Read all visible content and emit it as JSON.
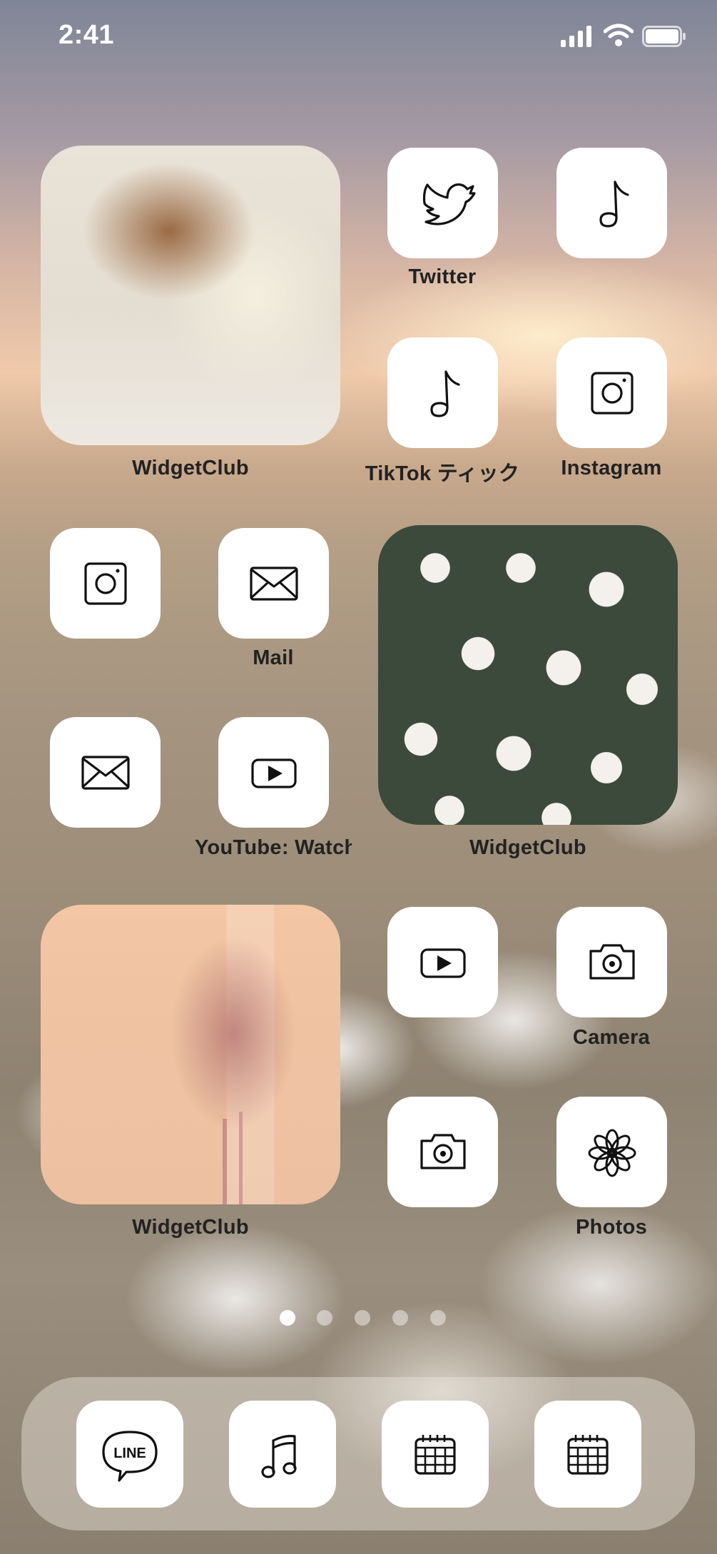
{
  "status": {
    "time": "2:41"
  },
  "widgets": [
    {
      "label": "WidgetClub",
      "photo": "wicker-basket-linen"
    },
    {
      "label": "WidgetClub",
      "photo": "white-daisies"
    },
    {
      "label": "WidgetClub",
      "photo": "dried-flowers-peach"
    }
  ],
  "apps": [
    {
      "label": "Twitter",
      "icon": "bird-icon"
    },
    {
      "label": "",
      "icon": "music-note-icon"
    },
    {
      "label": "TikTok ティック",
      "icon": "music-note-icon"
    },
    {
      "label": "Instagram",
      "icon": "instagram-icon"
    },
    {
      "label": "",
      "icon": "instagram-icon"
    },
    {
      "label": "Mail",
      "icon": "mail-icon"
    },
    {
      "label": "",
      "icon": "mail-icon"
    },
    {
      "label": "YouTube: Watch",
      "icon": "play-icon"
    },
    {
      "label": "",
      "icon": "play-icon"
    },
    {
      "label": "Camera",
      "icon": "camera-icon"
    },
    {
      "label": "",
      "icon": "camera-icon"
    },
    {
      "label": "Photos",
      "icon": "flower-icon"
    }
  ],
  "page_indicator": {
    "pages": 5,
    "current": 1
  },
  "dock": [
    {
      "icon": "line-icon",
      "text": "LINE"
    },
    {
      "icon": "music-notes-icon"
    },
    {
      "icon": "calendar-icon"
    },
    {
      "icon": "calendar-icon"
    }
  ]
}
